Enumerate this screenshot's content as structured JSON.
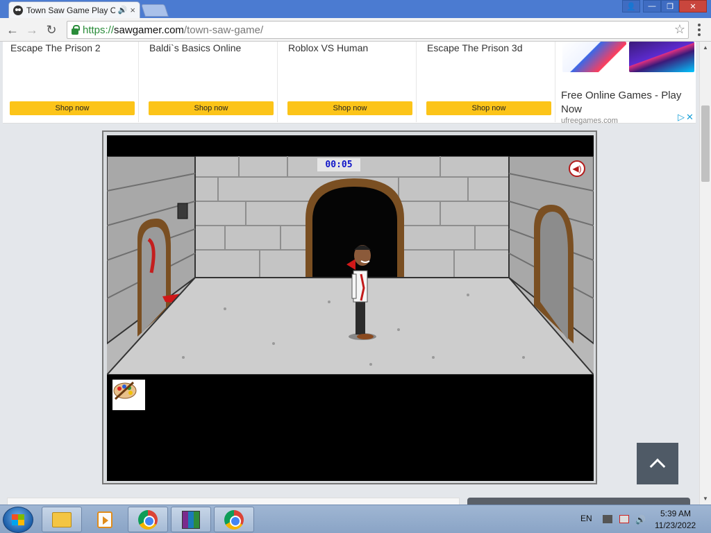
{
  "browser": {
    "tab_title": "Town Saw Game Play O",
    "audio_icon": "speaker-icon",
    "tab_close": "×",
    "window_buttons": {
      "user": "👤",
      "minimize": "—",
      "maximize": "❐",
      "close": "✕"
    },
    "url_scheme": "https://",
    "url_host": "sawgamer.com",
    "url_path": "/town-saw-game/"
  },
  "ads": {
    "cards": [
      {
        "title": "Escape The Prison 2",
        "button": "Shop now"
      },
      {
        "title": "Baldi`s Basics Online",
        "button": "Shop now"
      },
      {
        "title": "Roblox VS Human",
        "button": "Shop now"
      },
      {
        "title": "Escape The Prison 3d",
        "button": "Shop now"
      }
    ],
    "promo_title": "Free Online Games - Play Now",
    "promo_source": "ufreegames.com",
    "adchoices": "▷✕"
  },
  "game": {
    "timer": "00:05",
    "sound_icon": "speaker-icon",
    "inventory_item": "paint-palette-icon"
  },
  "taskbar": {
    "language": "EN",
    "time": "5:39 AM",
    "date": "11/23/2022"
  }
}
